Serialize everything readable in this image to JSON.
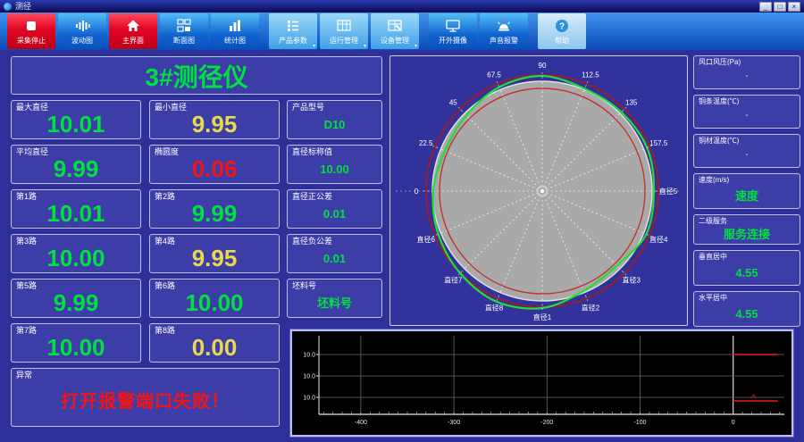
{
  "colors": {
    "green": "#00e040",
    "yellow": "#ead94e",
    "red": "#f21515",
    "white": "#dfe3ff",
    "window_bg": "#2f2f9a",
    "panel_bg": "#3d3da8",
    "panel_border": "#b9c2f0",
    "toolbar_red": "#e00424",
    "toolbar_blue": "#1064d0"
  },
  "window": {
    "title": "测径",
    "controls": {
      "minimize": "_",
      "maximize": "□",
      "close": "×"
    }
  },
  "toolbar": {
    "dropdown_glyph": "▾",
    "buttons": [
      {
        "label": "采集停止",
        "style": "red",
        "icon": "stop-icon"
      },
      {
        "label": "波动图",
        "style": "blue",
        "icon": "waveform-icon"
      },
      {
        "label": "主界面",
        "style": "red",
        "icon": "home-icon"
      },
      {
        "label": "断面图",
        "style": "blue",
        "icon": "section-windows-icon"
      },
      {
        "label": "统计图",
        "style": "blue",
        "icon": "bar-chart-icon"
      },
      {
        "label": "产品参数",
        "style": "light",
        "icon": "list-icon",
        "dropdown": true
      },
      {
        "label": "运行管理",
        "style": "light",
        "icon": "table-icon",
        "dropdown": true
      },
      {
        "label": "设备管理",
        "style": "light",
        "icon": "grid-edit-icon",
        "dropdown": true
      },
      {
        "label": "开外摄像",
        "style": "blue",
        "icon": "monitor-icon"
      },
      {
        "label": "声音报警",
        "style": "blue",
        "icon": "alarm-icon"
      },
      {
        "label": "帮助",
        "style": "pale",
        "icon": "help-icon"
      }
    ]
  },
  "left_panel": {
    "title": "3#测径仪",
    "cells": [
      {
        "label": "最大直径",
        "value": "10.01",
        "color": "green"
      },
      {
        "label": "最小直径",
        "value": "9.95",
        "color": "yellow"
      },
      {
        "label": "产品型号",
        "value": "D10",
        "color": "green"
      },
      {
        "label": "平均直径",
        "value": "9.99",
        "color": "green"
      },
      {
        "label": "椭圆度",
        "value": "0.06",
        "color": "red"
      },
      {
        "label": "直径标称值",
        "value": "10.00",
        "color": "green"
      },
      {
        "label": "第1路",
        "value": "10.01",
        "color": "green"
      },
      {
        "label": "第2路",
        "value": "9.99",
        "color": "green"
      },
      {
        "label": "直径正公差",
        "value": "0.01",
        "color": "green"
      },
      {
        "label": "第3路",
        "value": "10.00",
        "color": "green"
      },
      {
        "label": "第4路",
        "value": "9.95",
        "color": "yellow"
      },
      {
        "label": "直径负公差",
        "value": "0.01",
        "color": "green"
      },
      {
        "label": "第5路",
        "value": "9.99",
        "color": "green"
      },
      {
        "label": "第6路",
        "value": "10.00",
        "color": "green"
      },
      {
        "label": "坯料号",
        "value": "坯料号",
        "color": "green"
      },
      {
        "label": "第7路",
        "value": "10.00",
        "color": "green"
      },
      {
        "label": "第8路",
        "value": "0.00",
        "color": "yellow"
      }
    ],
    "abnormal": {
      "label": "异常",
      "value": "打开报警端口失败！",
      "color": "red"
    }
  },
  "right_panel": {
    "cells": [
      {
        "label": "风口风压(Pa)",
        "value": "-",
        "color": "white"
      },
      {
        "label": "铜条温度(℃)",
        "value": "-",
        "color": "white"
      },
      {
        "label": "铜材温度(℃)",
        "value": "-",
        "color": "white"
      },
      {
        "label": "速度(m/s)",
        "value": "速度",
        "color": "green"
      },
      {
        "label": "二级服务",
        "value": "服务连接",
        "color": "green"
      },
      {
        "label": "垂直居中",
        "value": "4.55",
        "color": "green"
      },
      {
        "label": "水平居中",
        "value": "4.55",
        "color": "green"
      }
    ]
  },
  "chart_data": [
    {
      "type": "polar",
      "title": "cross-section diameter profile",
      "labels": [
        "0",
        "22.5",
        "45",
        "67.5",
        "90",
        "112.5",
        "135",
        "157.5",
        "直径5",
        "直径4",
        "直径3",
        "直径2",
        "直径1",
        "直径8",
        "直径7",
        "直径6"
      ],
      "label_angles_deg": [
        180,
        157.5,
        135,
        112.5,
        90,
        67.5,
        45,
        22.5,
        0,
        -22.5,
        -45,
        -67.5,
        -90,
        -112.5,
        -135,
        -157.5
      ],
      "disc_radius": 123,
      "nominal_circle_radius": 115,
      "tolerance_circle_radius": 130,
      "label_radius": 141,
      "measured_angles_deg": [
        0,
        22.5,
        45,
        67.5,
        90,
        112.5,
        135,
        157.5,
        180,
        202.5,
        225,
        247.5,
        270,
        292.5,
        315,
        337.5
      ],
      "measured_radii": [
        125,
        127,
        125,
        124,
        129,
        126,
        120,
        118,
        122,
        126,
        130,
        134,
        131,
        121,
        118,
        126
      ],
      "colors": {
        "disc": "#a9a9a9",
        "rim": "#e0e0e0",
        "nominal": "#c23333",
        "tolerance": "#8c1f3f",
        "measured": "#22dd33",
        "spoke": "#ffffff",
        "label": "#ffffff"
      }
    },
    {
      "type": "line",
      "title": "diameter trend",
      "xlim": [
        -445,
        55
      ],
      "x_ticks": [
        -400,
        -300,
        -200,
        -100,
        0
      ],
      "y_tick_labels": [
        "10.0",
        "10.0",
        "10.0"
      ],
      "red_segments": [
        {
          "x1": 0,
          "x2": 48,
          "row": 0,
          "dy": 0
        },
        {
          "x1": 0,
          "x2": 48,
          "row": 2,
          "dy": 4
        }
      ],
      "marker": {
        "x": 22,
        "row": 2,
        "dy": 1
      },
      "grid": true,
      "colors": {
        "bg": "#000000",
        "grid": "#6a6a6a",
        "zero_line": "#d8d8d8",
        "axis": "#e8e8e8",
        "series": "#cc1515",
        "tick_label": "#e8e8e8"
      }
    }
  ]
}
